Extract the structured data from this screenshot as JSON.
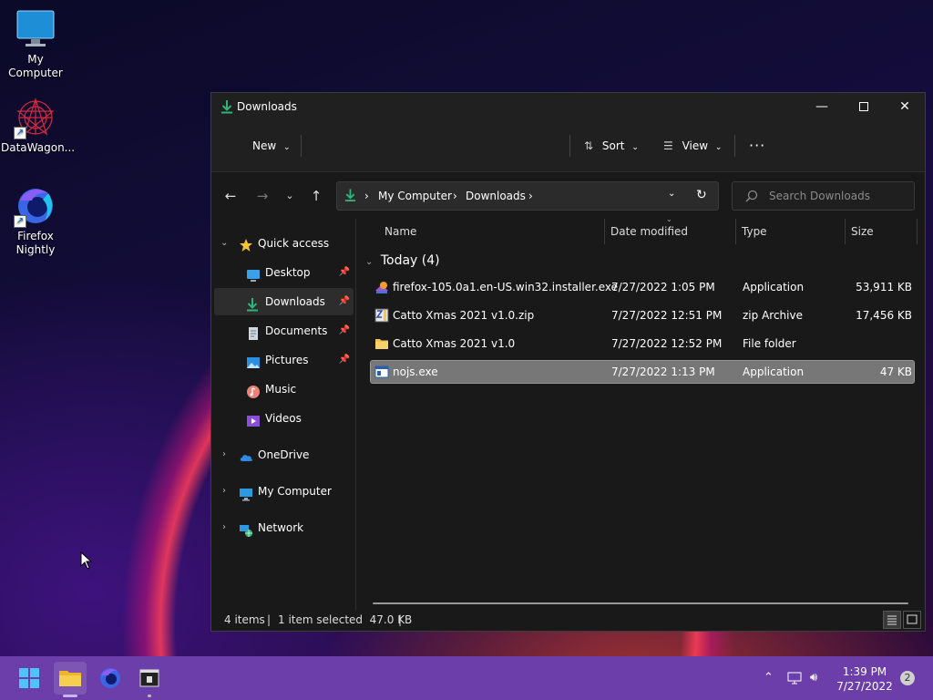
{
  "desktop": {
    "icons": [
      {
        "label": "My Computer"
      },
      {
        "label": "DataWagon..."
      },
      {
        "label": "Firefox Nightly"
      }
    ]
  },
  "window": {
    "title": "Downloads",
    "toolbar": {
      "new_label": "New",
      "sort_label": "Sort",
      "view_label": "View",
      "more_label": "···"
    },
    "address": {
      "crumbs": [
        "My Computer",
        "Downloads"
      ]
    },
    "search": {
      "placeholder": "Search Downloads"
    },
    "sidebar": {
      "quick_access": "Quick access",
      "items": [
        {
          "label": "Desktop",
          "pinned": true
        },
        {
          "label": "Downloads",
          "pinned": true
        },
        {
          "label": "Documents",
          "pinned": true
        },
        {
          "label": "Pictures",
          "pinned": true
        },
        {
          "label": "Music",
          "pinned": false
        },
        {
          "label": "Videos",
          "pinned": false
        }
      ],
      "roots": [
        {
          "label": "OneDrive"
        },
        {
          "label": "My Computer"
        },
        {
          "label": "Network"
        }
      ]
    },
    "columns": [
      "Name",
      "Date modified",
      "Type",
      "Size"
    ],
    "group_label": "Today (4)",
    "files": [
      {
        "name": "firefox-105.0a1.en-US.win32.installer.exe",
        "date": "7/27/2022 1:05 PM",
        "type": "Application",
        "size": "53,911 KB",
        "icon": "installer-icon"
      },
      {
        "name": "Catto Xmas 2021 v1.0.zip",
        "date": "7/27/2022 12:51 PM",
        "type": "zip Archive",
        "size": "17,456 KB",
        "icon": "zip-icon"
      },
      {
        "name": "Catto Xmas 2021 v1.0",
        "date": "7/27/2022 12:52 PM",
        "type": "File folder",
        "size": "",
        "icon": "folder-icon"
      },
      {
        "name": "nojs.exe",
        "date": "7/27/2022 1:13 PM",
        "type": "Application",
        "size": "47 KB",
        "icon": "exe-icon",
        "selected": true
      }
    ],
    "status": {
      "items": "4 items",
      "selected": "1 item selected  47.0 KB"
    }
  },
  "taskbar": {
    "time": "1:39 PM",
    "date": "7/27/2022",
    "notification_count": "2"
  },
  "colors": {
    "taskbar": "#6c3ea9",
    "accent": "#2fb37b",
    "selection": "#777777"
  }
}
